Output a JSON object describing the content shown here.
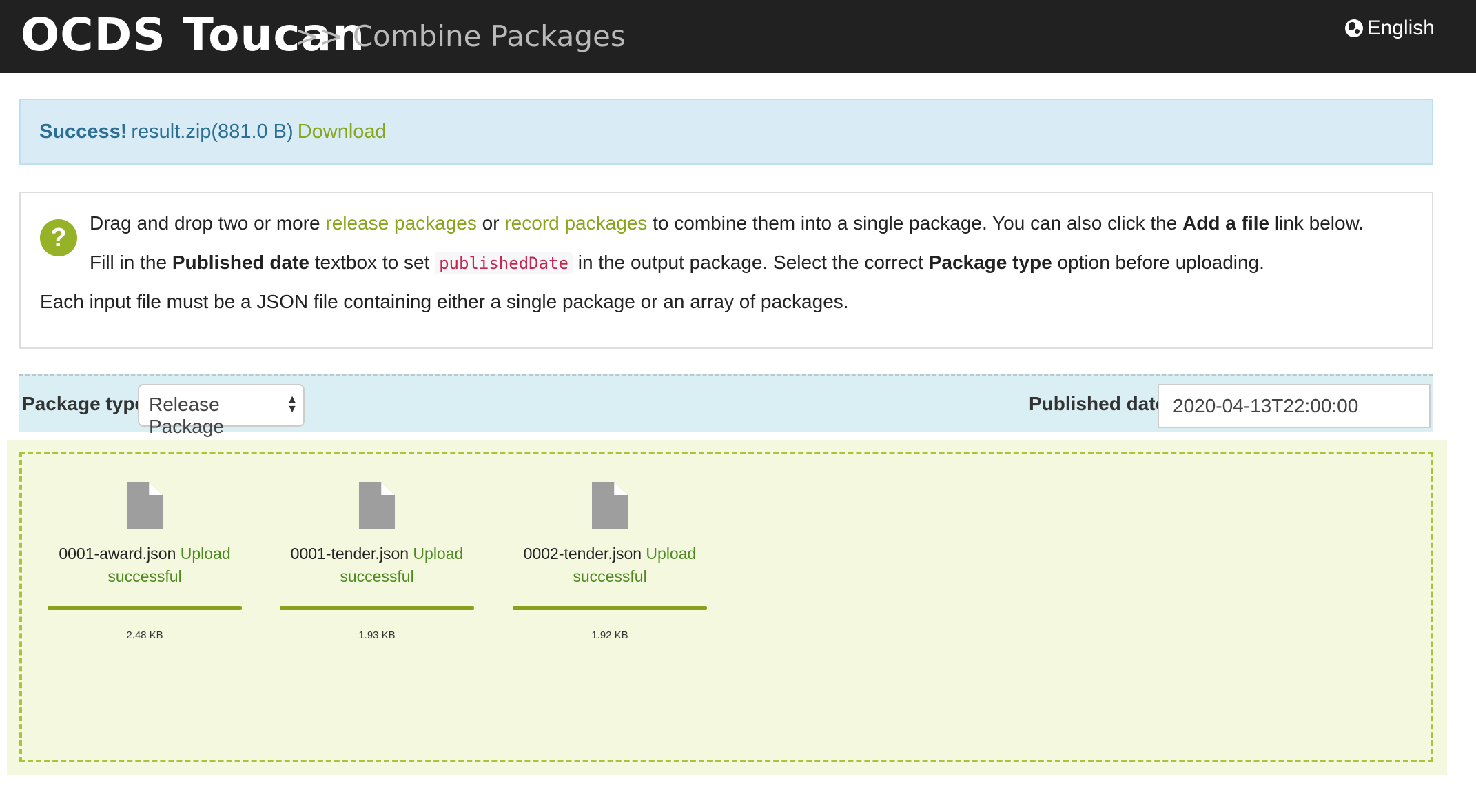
{
  "header": {
    "brand": "OCDS Toucan",
    "subtitle": ">> Combine Packages",
    "language": "English",
    "globe_icon": "globe-icon"
  },
  "alert": {
    "status": "Success!",
    "file": "result.zip(881.0 B)",
    "download_label": "Download"
  },
  "info": {
    "line1": {
      "p1": "Drag and drop two or more ",
      "link1": "release packages",
      "p2": " or ",
      "link2": "record packages",
      "p3": " to combine them into a single package. You can also click the ",
      "bold": "Add a file",
      "p4": " link below."
    },
    "line2": {
      "p1": "Fill in the ",
      "bold1": "Published date",
      "p2": " textbox to set ",
      "code": "publishedDate",
      "p3": " in the output package. Select the correct ",
      "bold2": "Package type",
      "p4": " option before uploading."
    },
    "line3": "Each input file must be a JSON file containing either a single package or an array of packages.",
    "help_icon_glyph": "?"
  },
  "options": {
    "package_type_label": "Package type:",
    "package_type_value": "Release Package",
    "published_date_label": "Published date:",
    "published_date_value": "2020-04-13T22:00:00"
  },
  "files": [
    {
      "name": "0001-award.json",
      "status_top": "Upload",
      "status_bottom": "successful",
      "size": "2.48 KB",
      "progress": 1.0
    },
    {
      "name": "0001-tender.json",
      "status_top": "Upload",
      "status_bottom": "successful",
      "size": "1.93 KB",
      "progress": 1.0
    },
    {
      "name": "0002-tender.json",
      "status_top": "Upload",
      "status_bottom": "successful",
      "size": "1.92 KB",
      "progress": 1.0
    }
  ],
  "colors": {
    "header_bg": "#212121",
    "accent_green": "#87a51d",
    "alert_bg": "#d9ecf5",
    "dropzone_bg": "#f4f8de"
  }
}
